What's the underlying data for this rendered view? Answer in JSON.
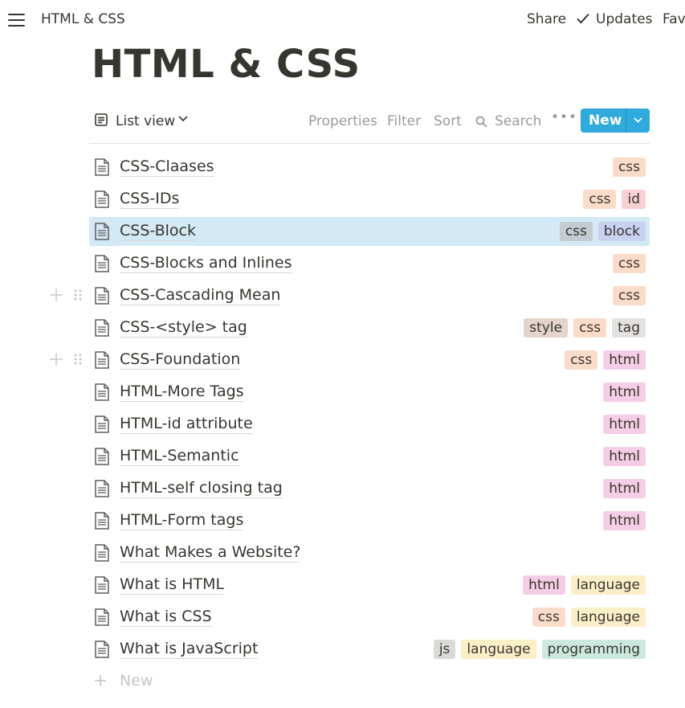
{
  "topbar": {
    "breadcrumb": "HTML & CSS",
    "share_label": "Share",
    "updates_label": "Updates",
    "fav_label": "Fav"
  },
  "page": {
    "title": "HTML & CSS"
  },
  "toolbar": {
    "view_label": "List view",
    "properties_label": "Properties",
    "filter_label": "Filter",
    "sort_label": "Sort",
    "search_label": "Search",
    "more_label": "•••",
    "new_label": "New"
  },
  "tag_colors": {
    "css": "#fbdcc8",
    "id": "#f8d0d4",
    "block": "#c9d1f0",
    "style": "#e5d3cd",
    "tag": "#e3e2e0",
    "html": "#f5cde6",
    "language": "#fbefc7",
    "js": "#d9d9d8",
    "programming": "#cde8de",
    "css_selected": "#c3ccd2"
  },
  "rows": [
    {
      "title": "CSS-Claases",
      "tags": [
        "css"
      ]
    },
    {
      "title": "CSS-IDs",
      "tags": [
        "css",
        "id"
      ]
    },
    {
      "title": "CSS-Block",
      "tags": [
        "css",
        "block"
      ],
      "selected": true
    },
    {
      "title": "CSS-Blocks and Inlines",
      "tags": [
        "css"
      ]
    },
    {
      "title": "CSS-Cascading Mean",
      "tags": [
        "css"
      ],
      "handle": true
    },
    {
      "title": "CSS-<style> tag",
      "tags": [
        "style",
        "css",
        "tag"
      ]
    },
    {
      "title": "CSS-Foundation",
      "tags": [
        "css",
        "html"
      ],
      "handle": true
    },
    {
      "title": "HTML-More Tags",
      "tags": [
        "html"
      ]
    },
    {
      "title": "HTML-id attribute",
      "tags": [
        "html"
      ]
    },
    {
      "title": "HTML-Semantic",
      "tags": [
        "html"
      ]
    },
    {
      "title": "HTML-self closing tag",
      "tags": [
        "html"
      ]
    },
    {
      "title": "HTML-Form tags",
      "tags": [
        "html"
      ]
    },
    {
      "title": "What Makes a Website?",
      "tags": []
    },
    {
      "title": "What is HTML",
      "tags": [
        "html",
        "language"
      ]
    },
    {
      "title": "What is CSS",
      "tags": [
        "css",
        "language"
      ]
    },
    {
      "title": "What is JavaScript",
      "tags": [
        "js",
        "language",
        "programming"
      ]
    }
  ],
  "add_new_label": "New"
}
